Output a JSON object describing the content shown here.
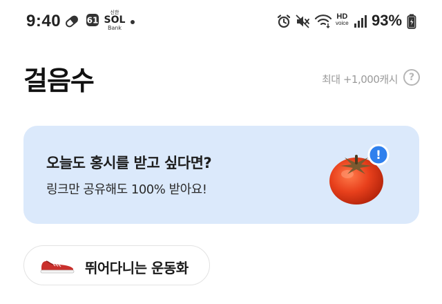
{
  "status_bar": {
    "time": "9:40",
    "app_notification": {
      "small": "신한",
      "main": "SOL",
      "sub": "Bank"
    },
    "network": {
      "hd": "HD",
      "voice": "voice"
    },
    "battery_percent": "93%"
  },
  "header": {
    "title": "걸음수",
    "max_reward": "최대 +1,000캐시",
    "help_symbol": "?"
  },
  "banner": {
    "title": "오늘도 홍시를 받고 싶다면?",
    "subtitle": "링크만 공유해도 100% 받아요!",
    "badge_symbol": "!"
  },
  "item": {
    "label": "뛰어다니는 운동화"
  },
  "colors": {
    "banner_bg": "#dbe9fb",
    "badge_blue": "#2f80ed",
    "persimmon": "#e8401c"
  },
  "icons": [
    "pill-icon",
    "message-badge-icon",
    "alarm-icon",
    "mute-icon",
    "wifi-icon",
    "signal-icon",
    "battery-icon",
    "help-icon",
    "persimmon-icon",
    "sneaker-icon"
  ]
}
